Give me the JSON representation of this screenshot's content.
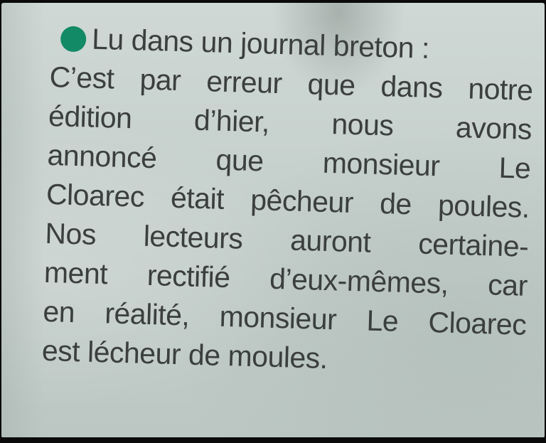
{
  "article": {
    "lines": [
      {
        "words": [
          "Lu",
          "dans",
          "un",
          "journal",
          "breton",
          ":"
        ],
        "ragged": true,
        "bullet": true
      },
      {
        "words": [
          "C’est",
          "par",
          "erreur",
          "que",
          "dans",
          "notre"
        ],
        "ragged": false
      },
      {
        "words": [
          "édition",
          "d’hier,",
          "nous",
          "avons"
        ],
        "ragged": false
      },
      {
        "words": [
          "annoncé",
          "que",
          "monsieur",
          "Le"
        ],
        "ragged": false
      },
      {
        "words": [
          "Cloarec",
          "était",
          "pêcheur",
          "de",
          "poules."
        ],
        "ragged": false
      },
      {
        "words": [
          "Nos",
          "lecteurs",
          "auront",
          "certaine-"
        ],
        "ragged": false
      },
      {
        "words": [
          "ment",
          "rectifié",
          "d’eux-mêmes,",
          "car"
        ],
        "ragged": false
      },
      {
        "words": [
          "en",
          "réalité,",
          "monsieur",
          "Le",
          "Cloarec"
        ],
        "ragged": false
      },
      {
        "words": [
          "est",
          "lécheur",
          "de",
          "moules."
        ],
        "ragged": true
      }
    ]
  },
  "colors": {
    "bullet": "#138a66",
    "ink": "#3b3f3e",
    "paper": "#c6d0cc"
  }
}
